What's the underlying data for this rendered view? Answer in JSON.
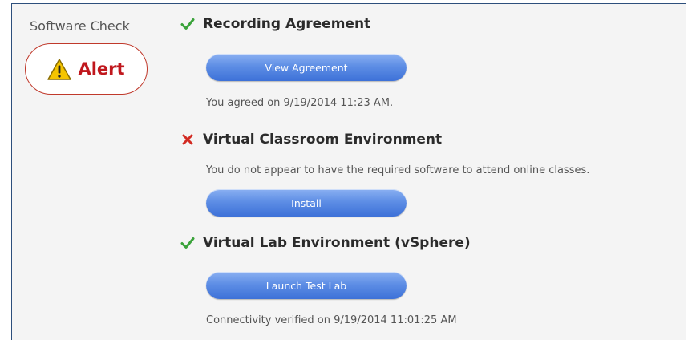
{
  "sidebar": {
    "title": "Software Check",
    "alert_label": "Alert"
  },
  "sections": [
    {
      "title": "Recording Agreement",
      "status": "pass",
      "button_label": "View Agreement",
      "note": "You agreed on 9/19/2014 11:23 AM."
    },
    {
      "title": "Virtual Classroom Environment",
      "status": "fail",
      "message": "You do not appear to have the required software to attend online classes.",
      "button_label": "Install"
    },
    {
      "title": "Virtual Lab Environment (vSphere)",
      "status": "pass",
      "button_label": "Launch Test Lab",
      "note": "Connectivity verified on 9/19/2014 11:01:25 AM"
    }
  ],
  "colors": {
    "pass": "#3aa33a",
    "fail": "#d22a22",
    "alert": "#c0171d",
    "button": "#4a7fe0",
    "border": "#2d4f7c"
  },
  "icons": {
    "pass": "check-icon",
    "fail": "x-icon",
    "alert": "warning-triangle-icon"
  }
}
